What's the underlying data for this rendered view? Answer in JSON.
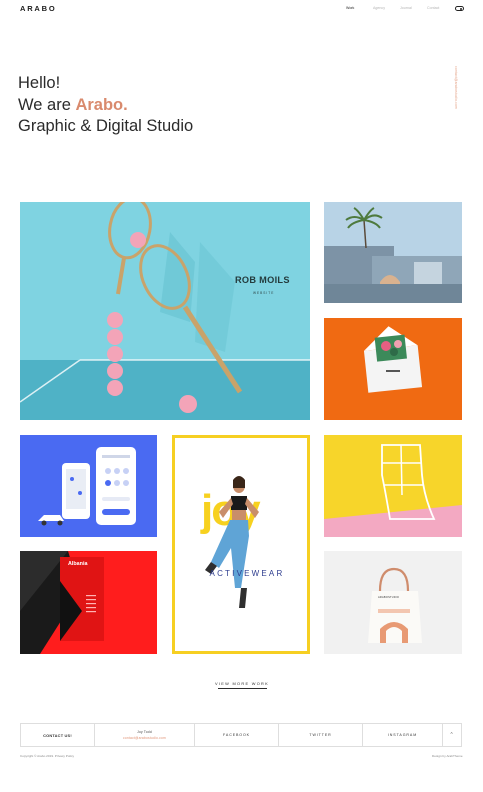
{
  "header": {
    "logo": "ARABO",
    "nav": [
      {
        "label": "Work",
        "active": true
      },
      {
        "label": "Agency",
        "active": false
      },
      {
        "label": "Journal",
        "active": false
      },
      {
        "label": "Contact",
        "active": false
      }
    ],
    "theme_toggle_icon": "toggle-icon"
  },
  "hero": {
    "line1": "Hello!",
    "line2_prefix": "We are ",
    "line2_brand": "Arabo.",
    "line3": "Graphic & Digital Studio",
    "brand_color": "#d98a6d"
  },
  "side_email": "contact@arabostudio.com",
  "tiles": {
    "rob": {
      "title": "ROB MOILS",
      "subtitle": "WEBSITE"
    },
    "joy": {
      "word": "joy",
      "subtitle": "ACTIVEWEAR"
    },
    "albania": {
      "title": "Albania"
    },
    "bag": {
      "brand": "ARABOSTUDIO"
    }
  },
  "view_more": "VIEW MORE WORK",
  "footer": {
    "contact_label": "CONTACT US!",
    "joy_label": "Joy Todd",
    "joy_email": "contact@arabostudio.com",
    "facebook": "FACEBOOK",
    "twitter": "TWITTER",
    "instagram": "INSTAGRAM",
    "copyright": "Copyright © Arabo 2019. Privacy Policy",
    "credit": "Design by ArabTheme"
  },
  "colors": {
    "accent": "#d98a6d",
    "joy_yellow": "#f6cf22",
    "tennis_blue": "#7fd3e1",
    "envelope_orange": "#f06a12",
    "app_blue": "#4a6af2",
    "albania_red": "#ff1d1d"
  }
}
